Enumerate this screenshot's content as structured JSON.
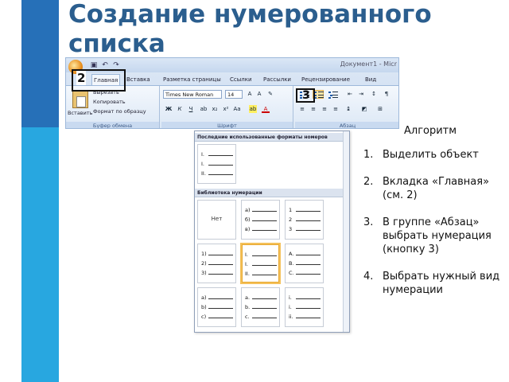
{
  "slide": {
    "title_line1": "Создание нумерованного",
    "title_line2": "списка"
  },
  "ribbon": {
    "document_title": "Документ1 - Micr",
    "tabs": [
      "Главная",
      "Вставка",
      "Разметка страницы",
      "Ссылки",
      "Рассылки",
      "Рецензирование",
      "Вид"
    ],
    "clipboard": {
      "paste_label": "Вставить",
      "cut_label": "Вырезать",
      "copy_label": "Копировать",
      "format_painter_label": "Формат по образцу",
      "group_label": "Буфер обмена"
    },
    "font": {
      "font_name": "Times New Roman",
      "font_size": "14",
      "group_label": "Шрифт"
    },
    "paragraph": {
      "group_label": "Абзац"
    },
    "icons": [
      "office-button-icon",
      "save-icon",
      "undo-icon",
      "redo-icon",
      "bullets-icon",
      "numbering-icon"
    ]
  },
  "callouts": {
    "tab_marker": "2",
    "button_marker": "3"
  },
  "numbering_menu": {
    "recent_header": "Последние использованные форматы номеров",
    "library_header": "Библиотека нумерации",
    "none_label": "Нет",
    "recent_markers": [
      "I.",
      "I.",
      "II."
    ],
    "library": [
      [
        "а)",
        "б)",
        "в)"
      ],
      [
        "1",
        "2",
        "3"
      ],
      [
        "1)",
        "2)",
        "3)"
      ],
      [
        "I.",
        "I.",
        "II."
      ],
      [
        "A.",
        "B.",
        "C."
      ],
      [
        "a)",
        "b)",
        "c)"
      ],
      [
        "a.",
        "b.",
        "c."
      ],
      [
        "i.",
        "i.",
        "ii."
      ]
    ]
  },
  "algorithm": {
    "title": "Алгоритм",
    "steps": [
      {
        "num": "1.",
        "text": "Выделить объект"
      },
      {
        "num": "2.",
        "text": "Вкладка «Главная» (см. 2)"
      },
      {
        "num": "3.",
        "text": " В группе «Абзац» выбрать нумерация (кнопку 3)"
      },
      {
        "num": "4.",
        "text": "Выбрать нужный вид нумерации"
      }
    ]
  },
  "colors": {
    "title": "#2b5e8e",
    "stripe_dark": "#2670b8",
    "stripe_light": "#28a7e0",
    "selected_tile": "#f4c15a"
  }
}
